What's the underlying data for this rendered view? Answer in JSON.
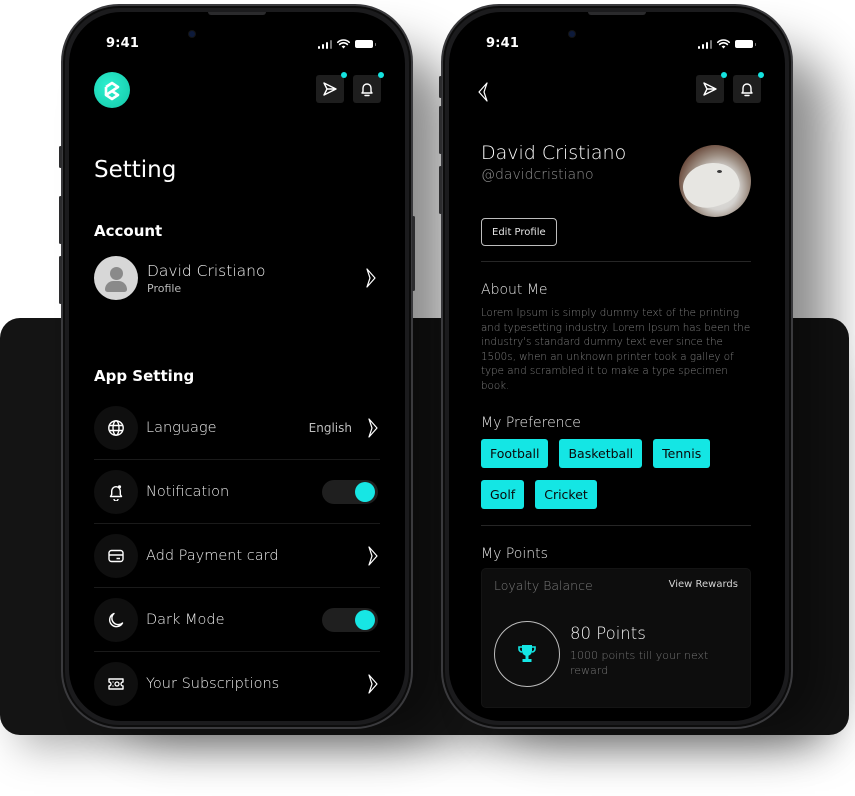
{
  "status_bar": {
    "time": "9:41"
  },
  "colors": {
    "accent": "#14E6E4",
    "logo": "#1ED9B8",
    "background": "#000000",
    "panel": "#141414"
  },
  "settings_screen": {
    "logo_icon": "brand-logo",
    "header_icons": [
      {
        "icon": "send-icon",
        "has_badge": true
      },
      {
        "icon": "bell-icon",
        "has_badge": true
      }
    ],
    "title": "Setting",
    "account": {
      "heading": "Account",
      "name": "David Cristiano",
      "subtitle": "Profile"
    },
    "app_setting": {
      "heading": "App Setting",
      "items": [
        {
          "label": "Language",
          "icon": "globe-icon",
          "value": "English",
          "control": "chevron"
        },
        {
          "label": "Notification",
          "icon": "bell-icon",
          "control": "toggle",
          "on": true
        },
        {
          "label": "Add Payment card",
          "icon": "card-icon",
          "control": "chevron"
        },
        {
          "label": "Dark Mode",
          "icon": "moon-icon",
          "control": "toggle",
          "on": true
        },
        {
          "label": "Your Subscriptions",
          "icon": "ticket-icon",
          "control": "chevron"
        }
      ]
    }
  },
  "profile_screen": {
    "name": "David Cristiano",
    "handle": "@davidcristiano",
    "edit_label": "Edit Profile",
    "about": {
      "heading": "About Me",
      "text": "Lorem Ipsum is simply dummy text of the printing and typesetting industry. Lorem Ipsum has been the industry's standard dummy text ever since the 1500s, when an unknown printer took a galley of type and scrambled it to make a type specimen book."
    },
    "preference": {
      "heading": "My Preference",
      "chips": [
        "Football",
        "Basketball",
        "Tennis",
        "Golf",
        "Cricket"
      ]
    },
    "points": {
      "heading": "My Points",
      "card_title": "Loyalty Balance",
      "link": "View Rewards",
      "value": "80 Points",
      "subtitle": "1000 points till your next reward"
    }
  }
}
